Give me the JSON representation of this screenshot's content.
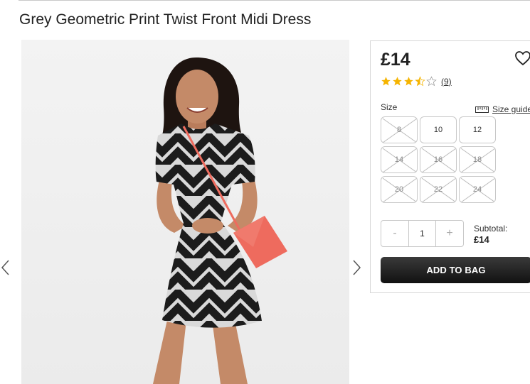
{
  "product": {
    "title": "Grey Geometric Print Twist Front Midi Dress",
    "price": "£14",
    "rating": {
      "value": 3.5,
      "max": 5,
      "count_label": "(9)"
    }
  },
  "icons": {
    "wishlist": "heart-icon",
    "prev": "chevron-left-icon",
    "next": "chevron-right-icon",
    "size_guide": "ruler-icon",
    "star_full": "star-icon",
    "star_half": "star-half-icon",
    "star_empty": "star-outline-icon"
  },
  "colors": {
    "star": "#f5b400",
    "button": "#1f1f1f",
    "bag": "#ee6b5e"
  },
  "sizes": {
    "label": "Size",
    "guide_label": "Size guide",
    "options": [
      {
        "label": "8",
        "available": false
      },
      {
        "label": "10",
        "available": true
      },
      {
        "label": "12",
        "available": true
      },
      {
        "label": "14",
        "available": false
      },
      {
        "label": "16",
        "available": false
      },
      {
        "label": "18",
        "available": false
      },
      {
        "label": "20",
        "available": false
      },
      {
        "label": "22",
        "available": false
      },
      {
        "label": "24",
        "available": false
      }
    ]
  },
  "quantity": {
    "minus": "-",
    "value": "1",
    "plus": "+"
  },
  "subtotal": {
    "label": "Subtotal:",
    "amount": "£14"
  },
  "cta": {
    "add_to_bag": "ADD TO BAG"
  }
}
